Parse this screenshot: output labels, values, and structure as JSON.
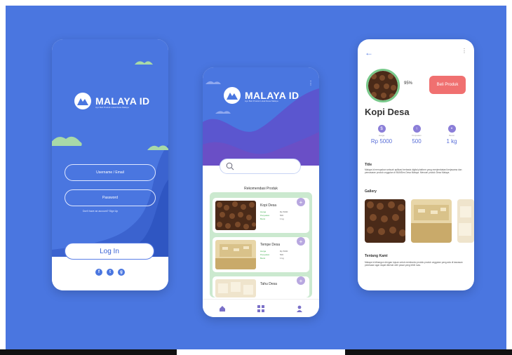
{
  "brand": {
    "name": "MALAYA ID",
    "tagline": "Ayo Beli Produk Lokal Desa Malaya"
  },
  "login": {
    "username_placeholder": "Username / Email",
    "password_placeholder": "Password",
    "signup_prompt": "Don't have an account?  Sign Up",
    "login_label": "Log In",
    "social_icons": [
      "facebook-icon",
      "twitter-icon",
      "google-icon"
    ]
  },
  "home": {
    "section_title": "Rekomendasi Produk",
    "row_labels": [
      "Harga",
      "Penjualan",
      "Berat"
    ],
    "products": [
      {
        "name": "Kopi Desa",
        "harga": "Rp 5000",
        "penjualan": "500",
        "berat": "1 kg"
      },
      {
        "name": "Tempe Desa",
        "harga": "Rp 5000",
        "penjualan": "500",
        "berat": "1 kg"
      },
      {
        "name": "Tahu Desa"
      }
    ],
    "nav_icons": [
      "home-icon",
      "grid-icon",
      "user-icon"
    ]
  },
  "detail": {
    "percent": "95%",
    "buy_label": "Beli Produk",
    "product_name": "Kopi Desa",
    "stats": [
      {
        "label": "Harga",
        "value": "Rp 5000"
      },
      {
        "label": "Penjualan",
        "value": "500"
      },
      {
        "label": "Berat",
        "value": "1 kg"
      }
    ],
    "title_heading": "Title",
    "title_text": "Malaya.id merupakan sebuah aplikasi berbasis digital platform yang menjembatani kerjasama dan pemasaran produk unggulan di BUMDes Desa Malaya. Mencari produk Desa Malaya.",
    "gallery_heading": "Gallery",
    "about_heading": "Tentang Kami",
    "about_text": "Malaya.id dibangun dengan tujuan untuk membantu produk-produk unggulan yang ada di kawasan pedesaan agar dapat dikenal oleh pasar yang lebih luas."
  },
  "colors": {
    "background": "#4a76e0",
    "accent_green": "#79c98b",
    "buy_button": "#f07070"
  }
}
